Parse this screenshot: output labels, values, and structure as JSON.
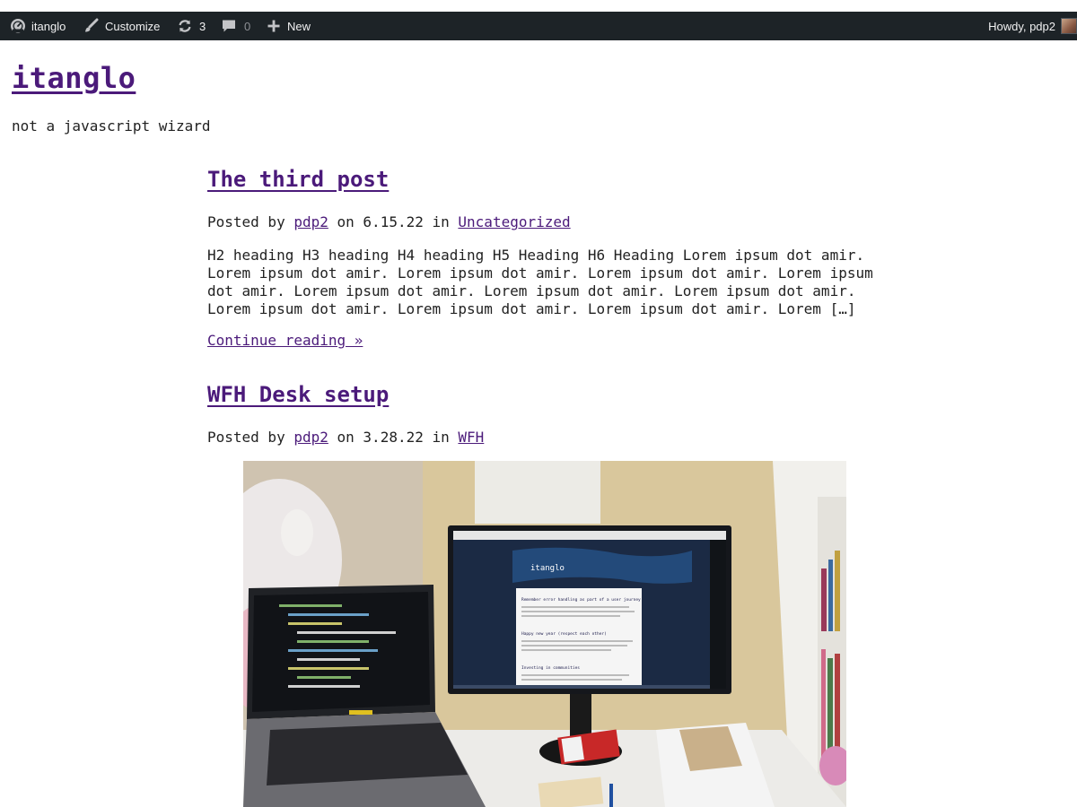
{
  "admin_bar": {
    "site_name": "itanglo",
    "customize_label": "Customize",
    "updates_count": "3",
    "comments_count": "0",
    "new_label": "New",
    "greeting": "Howdy, pdp2"
  },
  "site": {
    "title": "itanglo",
    "tagline": "not a javascript wizard"
  },
  "posts": [
    {
      "title": "The third post",
      "posted_by_label": "Posted by",
      "author": "pdp2",
      "on_label": "on",
      "date": "6.15.22",
      "in_label": "in",
      "category": "Uncategorized",
      "excerpt_lines": [
        "H2 heading H3 heading H4 heading H5 Heading H6 Heading Lorem ipsum dot amir.",
        "Lorem ipsum dot amir. Lorem ipsum dot amir. Lorem ipsum dot amir. Lorem ipsum",
        "dot amir. Lorem ipsum dot amir. Lorem ipsum dot amir. Lorem ipsum dot amir.",
        "Lorem ipsum dot amir. Lorem ipsum dot amir. Lorem ipsum dot amir. Lorem […]"
      ],
      "continue_label": "Continue reading »"
    },
    {
      "title": "WFH Desk setup",
      "posted_by_label": "Posted by",
      "author": "pdp2",
      "on_label": "on",
      "date": "3.28.22",
      "in_label": "in",
      "category": "WFH"
    }
  ],
  "photo_screen": {
    "site_title": "itanglo",
    "headings": [
      "Remember error handling as part of a user journey",
      "Happy new year (respect each other)",
      "Investing in communities"
    ]
  },
  "colors": {
    "admin_bar_bg": "#1d2327",
    "link_purple": "#4b1a7a",
    "text": "#222222"
  }
}
